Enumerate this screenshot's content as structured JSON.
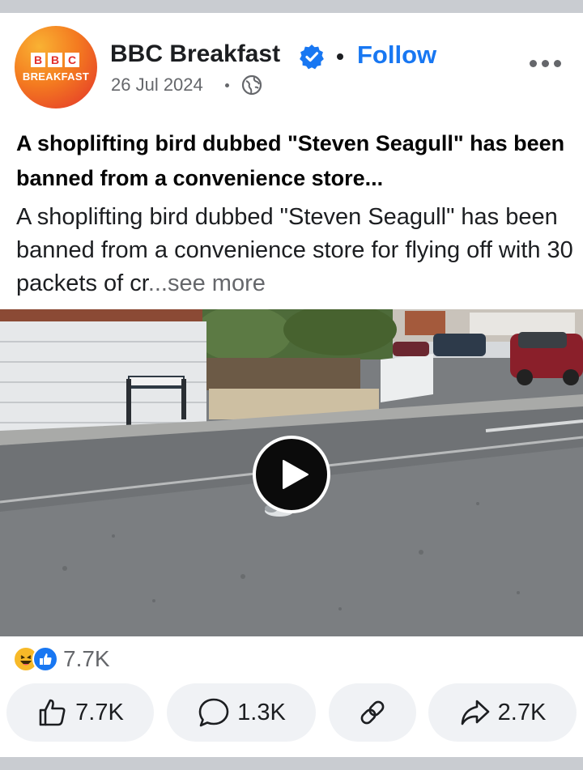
{
  "post": {
    "page_name": "BBC Breakfast",
    "follow_label": "Follow",
    "date": "26 Jul 2024",
    "avatar": {
      "blocks": [
        "B",
        "B",
        "C"
      ],
      "word": "BREAKFAST"
    },
    "headline": "A shoplifting bird dubbed \"Steven Seagull\" has been banned from a convenience store...",
    "body": "A shoplifting bird dubbed \"Steven Seagull\" has been banned from a convenience store for flying off with 30 packets of cr",
    "see_more": "...see more"
  },
  "reactions": {
    "count": "7.7K",
    "icons": [
      "haha-icon",
      "like-icon"
    ]
  },
  "actions": {
    "like_count": "7.7K",
    "comment_count": "1.3K",
    "share_count": "2.7K"
  },
  "colors": {
    "accent": "#1877f2",
    "muted": "#65676b",
    "pill_bg": "#f0f2f5"
  }
}
